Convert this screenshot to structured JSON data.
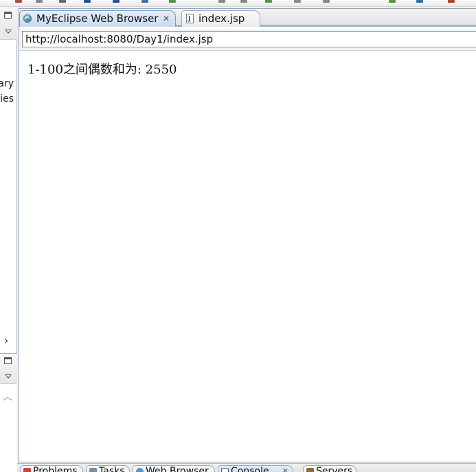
{
  "editor": {
    "tabs": [
      {
        "label": "MyEclipse Web Browser",
        "icon": "globe-icon",
        "active": true,
        "close": "✕"
      },
      {
        "label": "index.jsp",
        "icon": "jsp-file-icon",
        "active": false
      }
    ]
  },
  "browser": {
    "url": "http://localhost:8080/Day1/index.jsp",
    "content_text": "1-100之间偶数和为: 2550"
  },
  "left_panel": {
    "partial_labels": [
      "rary",
      "ies"
    ]
  },
  "bottom_panel": {
    "tabs": [
      {
        "label": "Problems",
        "icon": "problems-icon"
      },
      {
        "label": "Tasks",
        "icon": "tasks-icon"
      },
      {
        "label": "Web Browser",
        "icon": "globe-icon"
      },
      {
        "label": "Console",
        "icon": "console-icon",
        "close": "✕"
      },
      {
        "label": "Servers",
        "icon": "servers-icon"
      }
    ]
  },
  "colors": {
    "active_tab": "#c9dbf0",
    "tab_border": "#7f9ab9",
    "panel_border": "#9fb6d2"
  }
}
